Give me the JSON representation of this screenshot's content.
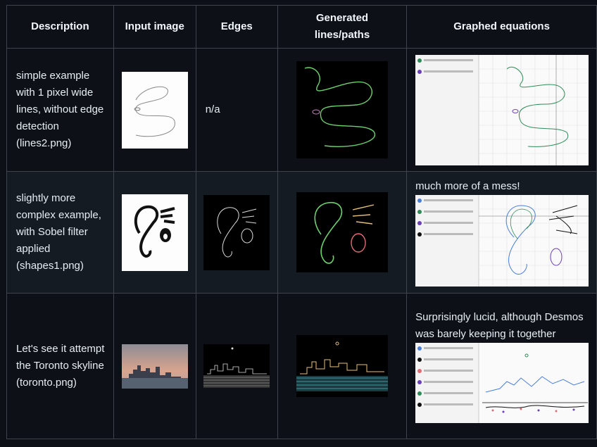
{
  "headers": [
    "Description",
    "Input image",
    "Edges",
    "Generated lines/paths",
    "Graphed equations"
  ],
  "rows": [
    {
      "description": "simple example with 1 pixel wide lines, without edge detection (lines2.png)",
      "edges": "n/a",
      "note": ""
    },
    {
      "description": "slightly more complex example, with Sobel filter applied (shapes1.png)",
      "edges": "",
      "note": "much more of a mess!"
    },
    {
      "description": "Let's see it attempt the Toronto skyline (toronto.png)",
      "edges": "",
      "note": "Surprisingly lucid, although Desmos was barely keeping it together"
    }
  ],
  "colors": {
    "background": "#0d1117",
    "row_alt": "#151b23",
    "border": "#3d444d",
    "text": "#e6edf3"
  }
}
